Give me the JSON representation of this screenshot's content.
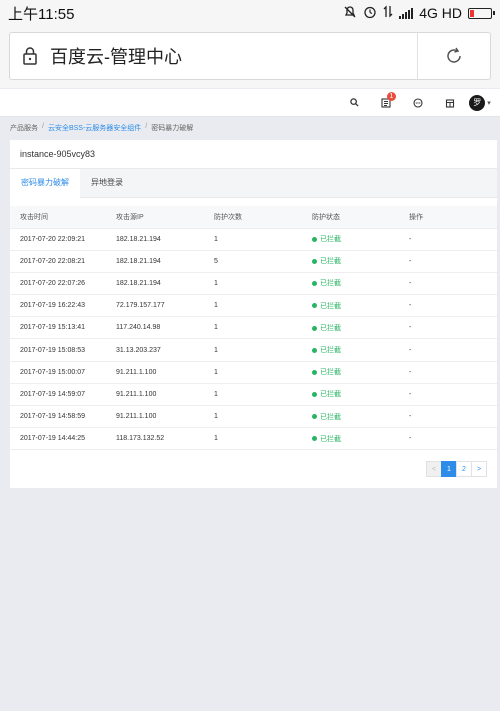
{
  "statusbar": {
    "time": "上午11:55",
    "network": "4G HD"
  },
  "browser": {
    "page_title": "百度云-管理中心"
  },
  "header": {
    "avatar_text": "罗",
    "notification_count": "1"
  },
  "breadcrumb": [
    "产品服务",
    "云安全BSS-云服务器安全组件",
    "密码暴力破解"
  ],
  "instance_name": "instance-905vcy83",
  "tabs": [
    "密码暴力破解",
    "异地登录"
  ],
  "table": {
    "headers": [
      "攻击时间",
      "攻击源IP",
      "防护次数",
      "防护状态",
      "操作"
    ],
    "rows": [
      [
        "2017-07-20 22:09:21",
        "182.18.21.194",
        "1",
        "已拦截",
        "-"
      ],
      [
        "2017-07-20 22:08:21",
        "182.18.21.194",
        "5",
        "已拦截",
        "-"
      ],
      [
        "2017-07-20 22:07:26",
        "182.18.21.194",
        "1",
        "已拦截",
        "-"
      ],
      [
        "2017-07-19 16:22:43",
        "72.179.157.177",
        "1",
        "已拦截",
        "-"
      ],
      [
        "2017-07-19 15:13:41",
        "117.240.14.98",
        "1",
        "已拦截",
        "-"
      ],
      [
        "2017-07-19 15:08:53",
        "31.13.203.237",
        "1",
        "已拦截",
        "-"
      ],
      [
        "2017-07-19 15:00:07",
        "91.211.1.100",
        "1",
        "已拦截",
        "-"
      ],
      [
        "2017-07-19 14:59:07",
        "91.211.1.100",
        "1",
        "已拦截",
        "-"
      ],
      [
        "2017-07-19 14:58:59",
        "91.211.1.100",
        "1",
        "已拦截",
        "-"
      ],
      [
        "2017-07-19 14:44:25",
        "118.173.132.52",
        "1",
        "已拦截",
        "-"
      ]
    ]
  },
  "pagination": {
    "prev": "<",
    "pages": [
      "1",
      "2"
    ],
    "next": ">"
  },
  "colors": {
    "accent": "#2d8ce8",
    "success": "#28b463",
    "badge": "#e84c3d"
  }
}
